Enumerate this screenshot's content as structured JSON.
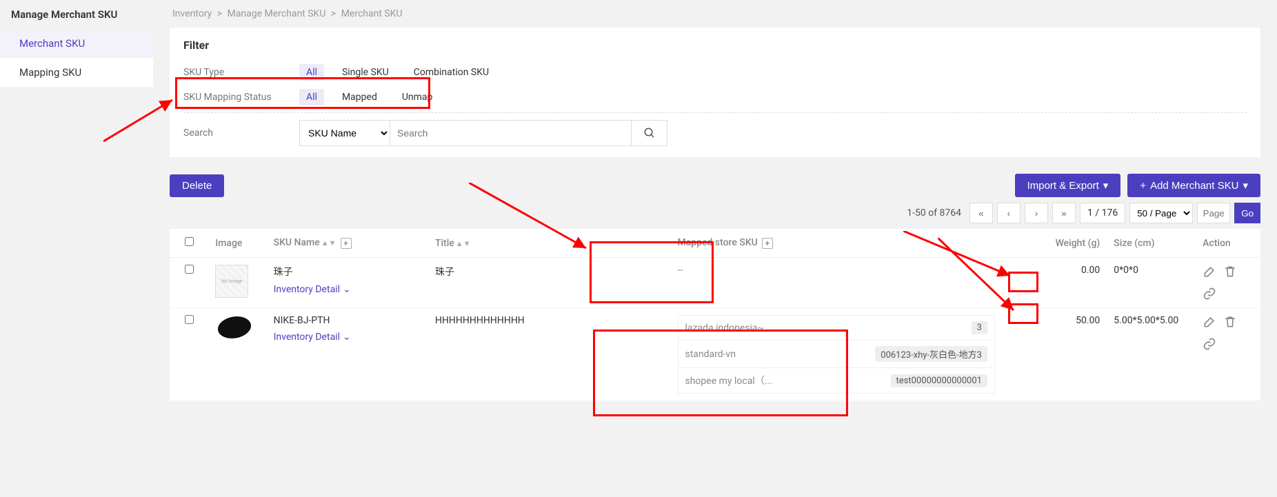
{
  "sidebar": {
    "title": "Manage Merchant SKU",
    "items": [
      {
        "label": "Merchant SKU",
        "active": true
      },
      {
        "label": "Mapping SKU",
        "active": false
      }
    ]
  },
  "breadcrumb": {
    "items": [
      "Inventory",
      "Manage Merchant SKU",
      "Merchant SKU"
    ],
    "sep": " > "
  },
  "filter": {
    "title": "Filter",
    "skuType": {
      "label": "SKU Type",
      "options": [
        "All",
        "Single SKU",
        "Combination SKU"
      ],
      "active": "All"
    },
    "mappingStatus": {
      "label": "SKU Mapping Status",
      "options": [
        "All",
        "Mapped",
        "Unmap"
      ],
      "active": "All"
    },
    "search": {
      "label": "Search",
      "select": "SKU Name",
      "placeholder": "Search",
      "value": ""
    }
  },
  "toolbar": {
    "delete": "Delete",
    "importExport": "Import & Export",
    "addMerchant": "Add Merchant SKU"
  },
  "pagination": {
    "summary": "1-50 of 8764",
    "pageIndicator": "1 / 176",
    "perPage": "50 / Page",
    "pagePlaceholder": "Page",
    "go": "Go"
  },
  "table": {
    "headers": {
      "image": "Image",
      "sku": "SKU Name",
      "title": "Title",
      "mapped": "Mapped store SKU",
      "weight": "Weight (g)",
      "size": "Size (cm)",
      "action": "Action"
    },
    "invDetail": "Inventory Detail",
    "rows": [
      {
        "sku": "珠子",
        "title": "珠子",
        "mapped": [],
        "mappedPlaceholder": "--",
        "weight": "0.00",
        "size": "0*0*0",
        "imgType": "none"
      },
      {
        "sku": "NIKE-BJ-PTH",
        "title": "HHHHHHHHHHHHH",
        "mapped": [
          {
            "store": "lazada indonesia~",
            "badge": "3"
          },
          {
            "store": "standard-vn",
            "badge": "006123-xhy-灰白色-地方3"
          },
          {
            "store": "shopee my local（...",
            "badge": "test00000000000001"
          }
        ],
        "weight": "50.00",
        "size": "5.00*5.00*5.00",
        "imgType": "mask"
      }
    ]
  }
}
